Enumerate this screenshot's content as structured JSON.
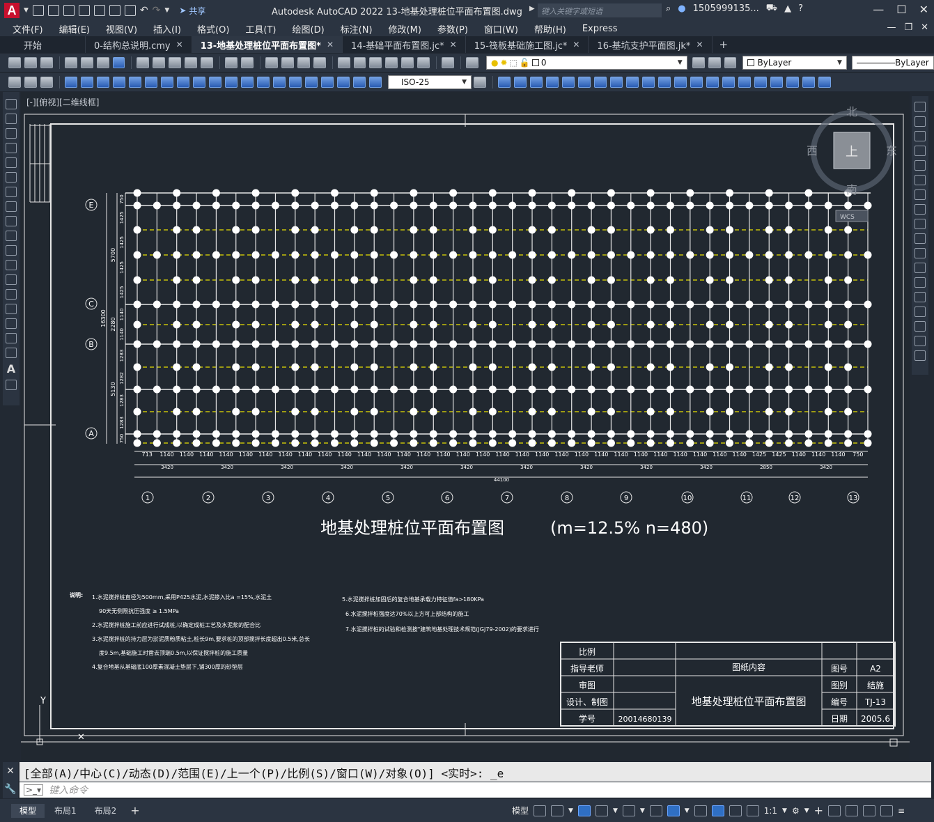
{
  "window": {
    "app_title": "Autodesk AutoCAD 2022    13-地基处理桩位平面布置图.dwg",
    "search_placeholder": "键入关键字或短语",
    "user": "1505999135...",
    "share_label": "共享",
    "logo_letter": "A"
  },
  "menu": [
    "文件(F)",
    "编辑(E)",
    "视图(V)",
    "插入(I)",
    "格式(O)",
    "工具(T)",
    "绘图(D)",
    "标注(N)",
    "修改(M)",
    "参数(P)",
    "窗口(W)",
    "帮助(H)",
    "Express"
  ],
  "tabs": [
    {
      "label": "开始",
      "active": false,
      "closable": false
    },
    {
      "label": "0-结构总说明.cmy",
      "active": false,
      "closable": true
    },
    {
      "label": "13-地基处理桩位平面布置图*",
      "active": true,
      "closable": true
    },
    {
      "label": "14-基础平面布置图.jc*",
      "active": false,
      "closable": true
    },
    {
      "label": "15-筏板基础施工图.jc*",
      "active": false,
      "closable": true
    },
    {
      "label": "16-基坑支护平面图.jk*",
      "active": false,
      "closable": true
    }
  ],
  "layer_combo": "0",
  "color_combo": "ByLayer",
  "linetype_combo": "ByLayer",
  "dimstyle_combo": "ISO-25",
  "viewport_label": "[-][俯视][二维线框]",
  "viewcube": {
    "north": "北",
    "south": "南",
    "east": "东",
    "west": "西",
    "top": "上",
    "wcs": "WCS"
  },
  "drawing": {
    "title": "地基处理桩位平面布置图",
    "params": "(m=12.5%    n=480)",
    "row_axes": [
      "E",
      "C",
      "B",
      "A"
    ],
    "col_axes": [
      "1",
      "2",
      "3",
      "4",
      "5",
      "6",
      "7",
      "8",
      "9",
      "10",
      "11",
      "12",
      "13"
    ],
    "col_dims_fine": [
      "713",
      "1140",
      "1140",
      "1140",
      "1140",
      "1140",
      "1140",
      "1140",
      "1140",
      "1140",
      "1140",
      "1140",
      "1140",
      "1140",
      "1140",
      "1140",
      "1140",
      "1140",
      "1140",
      "1140",
      "1140",
      "1140",
      "1140",
      "1140",
      "1140",
      "1140",
      "1140",
      "1140",
      "1140",
      "1140",
      "1140",
      "1425",
      "1425",
      "1140",
      "1140",
      "1140",
      "750"
    ],
    "col_dims_mid": [
      "3420",
      "3420",
      "3420",
      "3420",
      "3420",
      "3420",
      "3420",
      "3420",
      "3420",
      "3420",
      "2850",
      "3420"
    ],
    "col_dim_total": "44100",
    "row_dims_outer": [
      "16300"
    ],
    "row_dims_mid": [
      "5700",
      "2280",
      "5130"
    ],
    "row_dims_fine": [
      "750",
      "1425",
      "1425",
      "1425",
      "1425",
      "1140",
      "1140",
      "1283",
      "1282",
      "1283",
      "1283",
      "750"
    ],
    "notes_label": "说明:",
    "notes_left": [
      "1.水泥搅拌桩直径为500mm,采用P425水泥,水泥掺入比a =15%,水泥土",
      "90天无侧限抗压强度 ≥ 1.5MPa",
      "2.水泥搅拌桩施工前应进行试成桩,以确定成桩工艺及水泥浆的配合比",
      "3.水泥搅拌桩的持力层为淤泥质粉质粘土,桩长9m,要求桩的顶部搅拌长度超出0.5米,总长",
      "度9.5m,基础施工时凿去顶端0.5m,以保证搅拌桩的施工质量",
      "4.复合地基从基础底100厚素混凝土垫层下,铺300厚的砂垫层"
    ],
    "notes_right": [
      "5.水泥搅拌桩加固后的复合地基承载力特征值fa>180KPa",
      "6.水泥搅拌桩强度达70%以上方可上部结构的施工",
      "7.水泥搅拌桩的试验和检测按\"建筑地基处理技术规范(JGJ79-2002)的要求进行"
    ],
    "titleblock": {
      "labels": [
        "比例",
        "指导老师",
        "审图",
        "设计、制图",
        "学号"
      ],
      "student_id": "20014680139",
      "content_header": "图纸内容",
      "content": "地基处理桩位平面布置图",
      "right_labels": [
        "图号",
        "图别",
        "编号",
        "日期"
      ],
      "right_values": [
        "A2",
        "结施",
        "TJ-13",
        "2005.6"
      ]
    },
    "ucs_y": "Y"
  },
  "command": {
    "history": "[全部(A)/中心(C)/动态(D)/范围(E)/上一个(P)/比例(S)/窗口(W)/对象(O)] <实时>: _e",
    "input_placeholder": "键入命令"
  },
  "layout_tabs": [
    "模型",
    "布局1",
    "布局2"
  ],
  "status": {
    "model_label": "模型",
    "scale": "1:1"
  },
  "colors": {
    "canvas": "#212830",
    "chrome": "#2b3441",
    "pile": "#ffffff",
    "gridline_dash": "#e8e000"
  }
}
